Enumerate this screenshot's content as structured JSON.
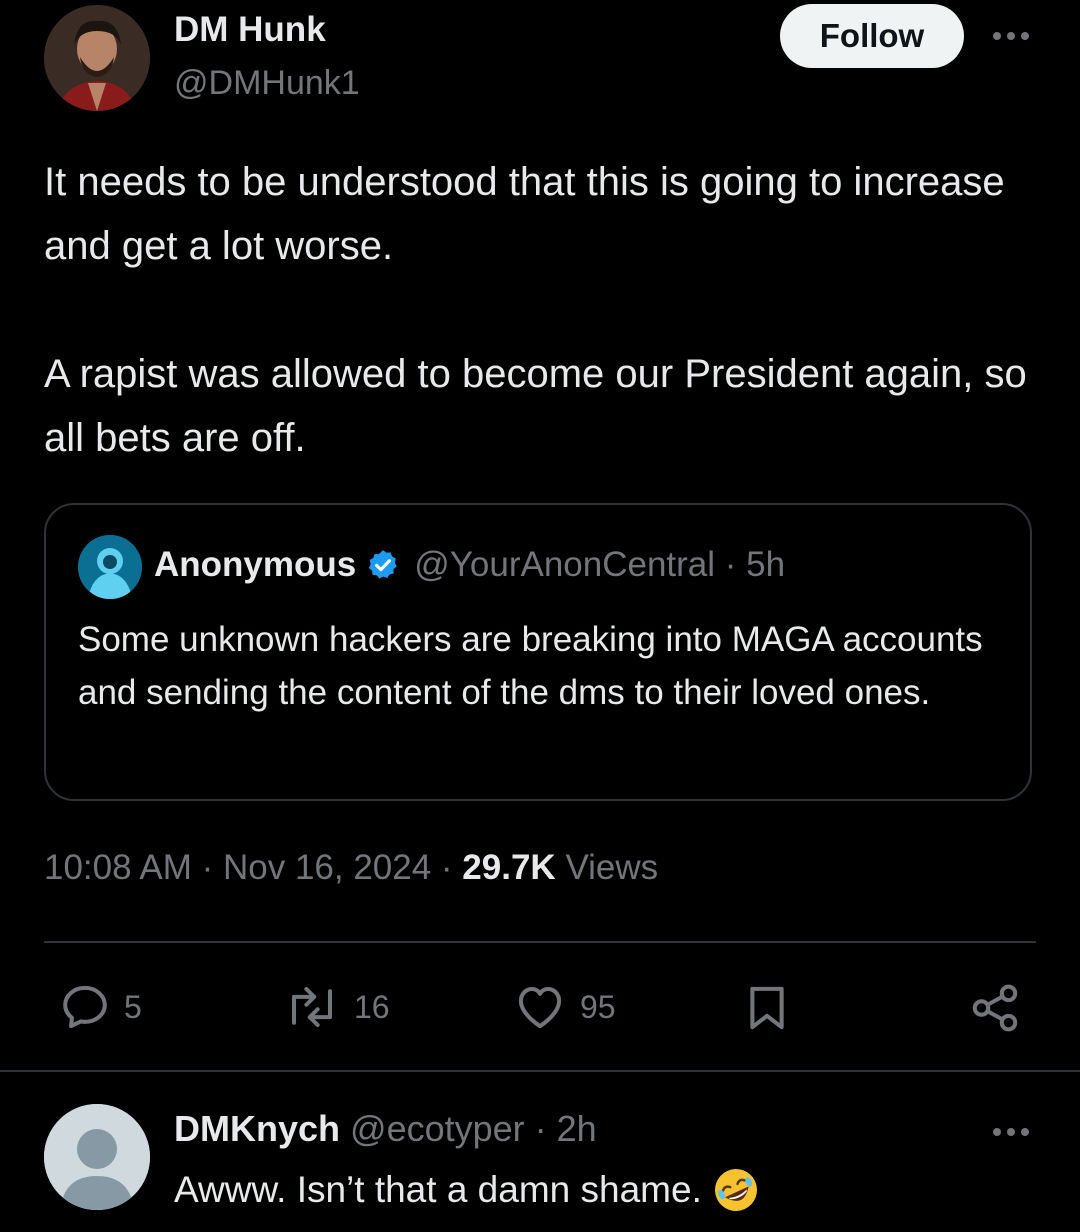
{
  "tweet": {
    "author_name": "DM Hunk",
    "author_handle": "@DMHunk1",
    "follow_label": "Follow",
    "paragraphs": [
      "It needs to be understood that this is going to increase and get a lot worse.",
      "A rapist was allowed to become our President again, so all bets are off."
    ],
    "timestamp": "10:08 AM · Nov 16, 2024 · ",
    "views_count": "29.7K",
    "views_label": "Views"
  },
  "quote": {
    "name": "Anonymous",
    "handle_time": "@YourAnonCentral · 5h",
    "text": "Some unknown hackers are breaking into MAGA accounts and sending the content of the dms to their loved ones."
  },
  "actions": {
    "replies": "5",
    "reposts": "16",
    "likes": "95"
  },
  "reply": {
    "name": "DMKnych",
    "handle_time": "@ecotyper · 2h",
    "text": "Awww. Isn’t that a damn shame.",
    "emoji": "🤣"
  },
  "colors": {
    "background": "#000000",
    "text": "#e7e9ea",
    "muted": "#71767b",
    "border": "#2f3336",
    "verified": "#1d9bf0"
  },
  "icons": [
    "more-icon",
    "verified-icon",
    "reply-icon",
    "repost-icon",
    "like-icon",
    "bookmark-icon",
    "share-icon"
  ]
}
